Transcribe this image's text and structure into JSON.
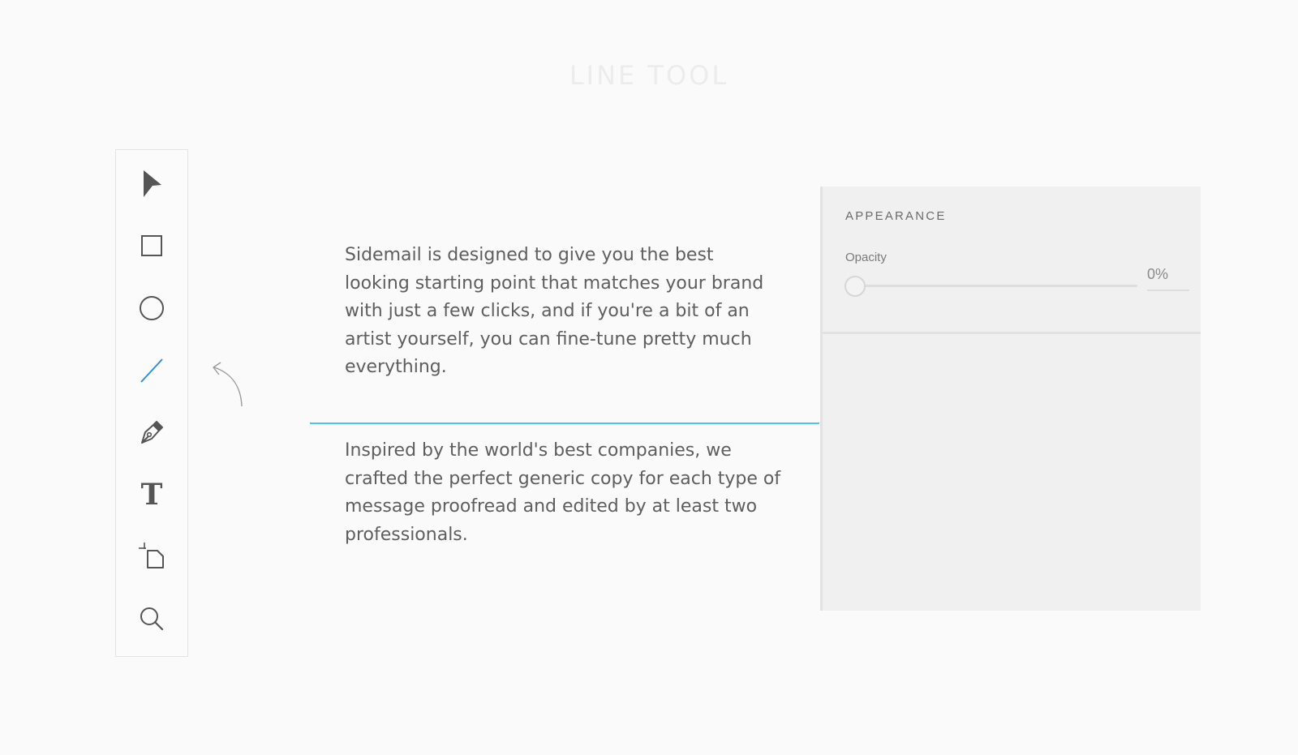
{
  "page": {
    "title": "LINE TOOL"
  },
  "toolbar": {
    "tools": [
      {
        "name": "select",
        "icon": "arrow-pointer-icon",
        "active": false
      },
      {
        "name": "rectangle",
        "icon": "rectangle-icon",
        "active": false
      },
      {
        "name": "ellipse",
        "icon": "ellipse-icon",
        "active": false
      },
      {
        "name": "line",
        "icon": "line-icon",
        "active": true
      },
      {
        "name": "pen",
        "icon": "pen-icon",
        "active": false
      },
      {
        "name": "text",
        "icon": "text-icon",
        "active": false
      },
      {
        "name": "artboard",
        "icon": "artboard-icon",
        "active": false
      },
      {
        "name": "zoom",
        "icon": "magnifier-icon",
        "active": false
      }
    ],
    "text_tool_glyph": "T"
  },
  "content": {
    "paragraph_1": "Sidemail is designed to give you the best looking starting point that matches your brand with just a few clicks, and if you're a bit of an artist yourself, you can fine-tune pretty much everything.",
    "paragraph_2": "Inspired by the world's best companies, we crafted the perfect generic copy for each type of message proofread and edited by at least two professionals."
  },
  "panel": {
    "title": "APPEARANCE",
    "opacity_label": "Opacity",
    "opacity_value": "0%",
    "opacity_fraction": 0
  },
  "colors": {
    "accent": "#2f8fd8",
    "drawn_line": "#4fc3e8",
    "icon": "#555555",
    "background": "#fafafa",
    "panel_background": "#f0f0f0"
  }
}
